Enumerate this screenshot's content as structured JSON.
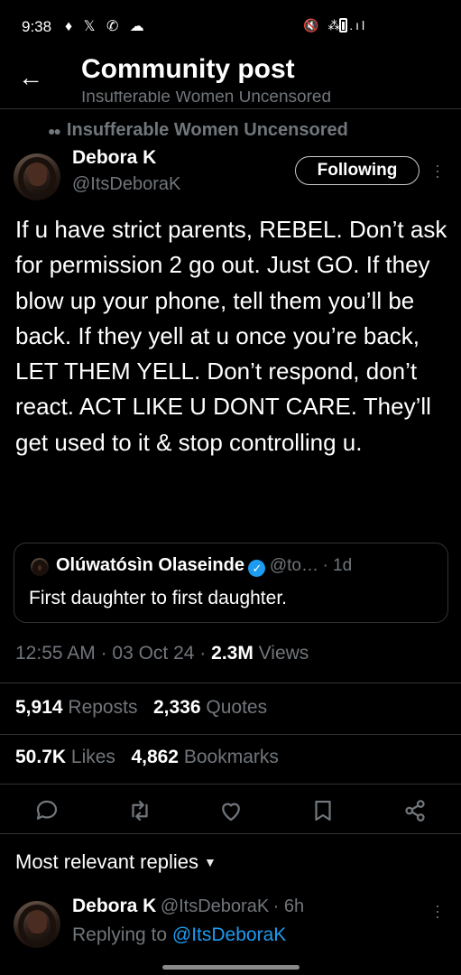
{
  "status_bar": {
    "time": "9:38",
    "left_icons": "♦ 𝕏 ✆ ☁",
    "right_icons": "🔇 ⁂ .ıl"
  },
  "header": {
    "title": "Community post",
    "subtitle": "Insufferable Women Uncensored"
  },
  "post": {
    "community": "Insufferable Women Uncensored",
    "author_name": "Debora K",
    "author_handle": "@ItsDeboraK",
    "follow_label": "Following",
    "text": "If u have strict parents, REBEL. Don’t ask for permission 2 go out. Just GO. If they blow up your phone, tell them you’ll be back. If they yell at u once you’re back, LET THEM YELL. Don’t respond, don’t react. ACT LIKE U DONT CARE. They’ll get used to it & stop controlling u.",
    "quote": {
      "name": "Olúwatósìn Olaseinde",
      "handle": "@to…",
      "age": "· 1d",
      "text": "First daughter to first daughter."
    },
    "time": "12:55 AM",
    "date": "03 Oct 24",
    "views_count": "2.3M",
    "views_label": "Views",
    "reposts_count": "5,914",
    "reposts_label": "Reposts",
    "quotes_count": "2,336",
    "quotes_label": "Quotes",
    "likes_count": "50.7K",
    "likes_label": "Likes",
    "bookmarks_count": "4,862",
    "bookmarks_label": "Bookmarks"
  },
  "actions": [
    "reply-icon",
    "repost-icon",
    "like-icon",
    "bookmark-icon",
    "share-icon"
  ],
  "replies": {
    "header": "Most relevant replies",
    "first": {
      "name": "Debora K",
      "handle": "@ItsDeboraK",
      "age": "· 6h",
      "replying_label": "Replying to",
      "replying_handle": "@ItsDeboraK"
    }
  },
  "colors": {
    "background": "#000000",
    "text": "#e7e9ea",
    "muted": "#71767b",
    "accent": "#1d9bf0",
    "divider": "#2f3336"
  }
}
